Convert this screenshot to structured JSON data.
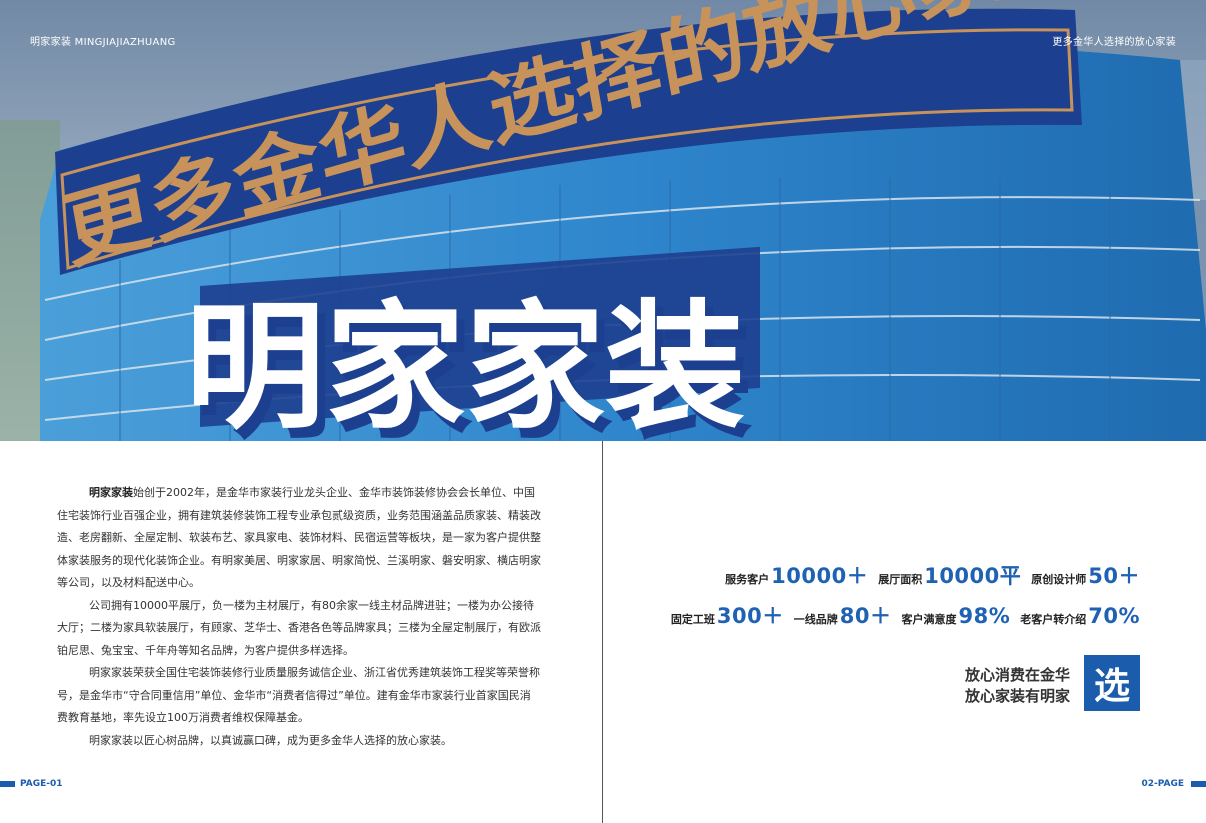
{
  "header": {
    "left": "明家家装 MINGJIAJIAZHUANG",
    "right": "更多金华人选择的放心家装"
  },
  "hero": {
    "banner_text": "更多金华人选择的放心家装",
    "brand_text": "明家家装"
  },
  "intro": {
    "p1_bold": "明家家装",
    "p1_rest": "始创于2002年，是金华市家装行业龙头企业、金华市装饰装修协会会长单位、中国住宅装饰行业百强企业，拥有建筑装修装饰工程专业承包贰级资质，业务范围涵盖品质家装、精装改造、老房翻新、全屋定制、软装布艺、家具家电、装饰材料、民宿运营等板块，是一家为客户提供整体家装服务的现代化装饰企业。有明家美居、明家家居、明家简悦、兰溪明家、磐安明家、横店明家等公司，以及材料配送中心。",
    "p2": "公司拥有10000平展厅，负一楼为主材展厅，有80余家一线主材品牌进驻；一楼为办公接待大厅；二楼为家具软装展厅，有顾家、芝华士、香港各色等品牌家具；三楼为全屋定制展厅，有欧派铂尼思、兔宝宝、千年舟等知名品牌，为客户提供多样选择。",
    "p3": "明家家装荣获全国住宅装饰装修行业质量服务诚信企业、浙江省优秀建筑装饰工程奖等荣誉称号，是金华市“守合同重信用”单位、金华市“消费者信得过”单位。建有金华市家装行业首家国民消费教育基地，率先设立100万消费者维权保障基金。",
    "p4": "明家家装以匠心树品牌，以真诚赢口碑，成为更多金华人选择的放心家装。"
  },
  "stats": {
    "row1": [
      {
        "label": "服务客户",
        "value": "10000＋"
      },
      {
        "label": "展厅面积",
        "value": "10000平"
      },
      {
        "label": "原创设计师",
        "value": "50＋"
      }
    ],
    "row2": [
      {
        "label": "固定工班",
        "value": "300＋"
      },
      {
        "label": "一线品牌",
        "value": "80＋"
      },
      {
        "label": "客户满意度",
        "value": "98%"
      },
      {
        "label": "老客户转介绍",
        "value": "70%"
      }
    ]
  },
  "slogan": {
    "line1": "放心消费在金华",
    "line2": "放心家装有明家",
    "badge": "选"
  },
  "footer": {
    "left_page": "PAGE-01",
    "right_page": "02-PAGE"
  },
  "colors": {
    "accent": "#1c5cad",
    "banner_text": "#c8935a",
    "facade": "#2e7fc6"
  }
}
